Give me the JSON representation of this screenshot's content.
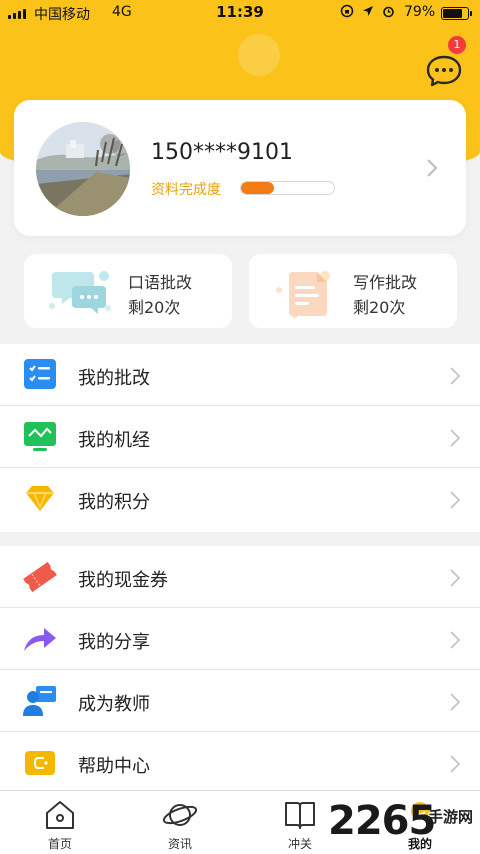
{
  "status_bar": {
    "carrier": "中国移动",
    "network": "4G",
    "time": "11:39",
    "battery": "79%",
    "battery_level": 0.79
  },
  "header": {
    "messages_badge": "1"
  },
  "profile": {
    "phone": "150****9101",
    "completeness_label": "资料完成度",
    "completeness_progress": 0.36
  },
  "quick_cards": [
    {
      "title": "口语批改",
      "remaining": "剩20次",
      "icon": "speech-chat-icon"
    },
    {
      "title": "写作批改",
      "remaining": "剩20次",
      "icon": "writing-note-icon"
    }
  ],
  "menu_group_1": [
    {
      "label": "我的批改",
      "icon": "checklist-icon",
      "color": "#2b8cf2"
    },
    {
      "label": "我的机经",
      "icon": "monitor-chart-icon",
      "color": "#22c05a"
    },
    {
      "label": "我的积分",
      "icon": "diamond-icon",
      "color": "#f5b800"
    }
  ],
  "menu_group_2": [
    {
      "label": "我的现金券",
      "icon": "ticket-icon",
      "color": "#f05a4a"
    },
    {
      "label": "我的分享",
      "icon": "share-arrow-icon",
      "color": "#8a5af0"
    },
    {
      "label": "成为教师",
      "icon": "teacher-icon",
      "color": "#2b8cf2"
    },
    {
      "label": "帮助中心",
      "icon": "help-wallet-icon",
      "color": "#f5b800"
    }
  ],
  "tabbar": [
    {
      "label": "首页",
      "icon": "home-icon"
    },
    {
      "label": "资讯",
      "icon": "planet-icon"
    },
    {
      "label": "冲关",
      "icon": "book-icon"
    },
    {
      "label": "我的",
      "icon": "profile-icon",
      "active": true
    }
  ],
  "watermark": {
    "number": "2265",
    "site": "手游网"
  },
  "colors": {
    "brand_yellow": "#fbc31a",
    "progress_orange": "#f47c14",
    "label_orange": "#e8a10d",
    "badge_red": "#f23c3c"
  }
}
